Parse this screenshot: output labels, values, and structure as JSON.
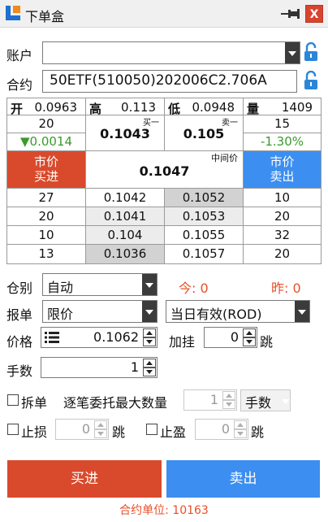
{
  "window": {
    "title": "下单盒",
    "close_glyph": "X"
  },
  "account": {
    "label": "账户",
    "value": ""
  },
  "contract": {
    "label": "合约",
    "value": "50ETF(510050)202006C2.706A"
  },
  "quote": {
    "open_label": "开",
    "open": "0.0963",
    "high_label": "高",
    "high": "0.113",
    "low_label": "低",
    "low": "0.0948",
    "volume_label": "量",
    "volume": "1409",
    "bid_size": "20",
    "bid1_label": "买一",
    "bid1": "0.1043",
    "ask1_label": "卖一",
    "ask1": "0.105",
    "ask_size": "15",
    "change": "▼0.0014",
    "change_pct": "-1.30%",
    "market_buy_label": "市价\n买进",
    "market_buy_l1": "市价",
    "market_buy_l2": "买进",
    "mid_label": "中间价",
    "mid": "0.1047",
    "market_sell_l1": "市价",
    "market_sell_l2": "卖出"
  },
  "depth": [
    {
      "bid_size": "27",
      "bid": "0.1042",
      "ask": "0.1052",
      "ask_size": "10"
    },
    {
      "bid_size": "20",
      "bid": "0.1041",
      "ask": "0.1053",
      "ask_size": "20"
    },
    {
      "bid_size": "10",
      "bid": "0.104",
      "ask": "0.1055",
      "ask_size": "32"
    },
    {
      "bid_size": "13",
      "bid": "0.1036",
      "ask": "0.1057",
      "ask_size": "20"
    }
  ],
  "position": {
    "label": "仓别",
    "value": "自动",
    "today": "今: 0",
    "yesterday": "昨: 0"
  },
  "order": {
    "label": "报单",
    "type": "限价",
    "validity": "当日有效(ROD)"
  },
  "price": {
    "label": "价格",
    "value": "0.1062",
    "add_label": "加挂",
    "add_value": "0",
    "tick_label": "跳"
  },
  "qty": {
    "label": "手数",
    "value": "1"
  },
  "split": {
    "label": "拆单",
    "max_label": "逐笔委托最大数量",
    "max_value": "1",
    "unit": "手数"
  },
  "stop_loss": {
    "label": "止损",
    "value": "0",
    "tick_label": "跳"
  },
  "take_profit": {
    "label": "止盈",
    "value": "0",
    "tick_label": "跳"
  },
  "actions": {
    "buy": "买进",
    "sell": "卖出"
  },
  "footer": "合约单位: 10163",
  "colors": {
    "buy": "#d94a2c",
    "sell": "#3c8ef0",
    "down": "#3a9a2a",
    "accent": "#e8502a"
  }
}
